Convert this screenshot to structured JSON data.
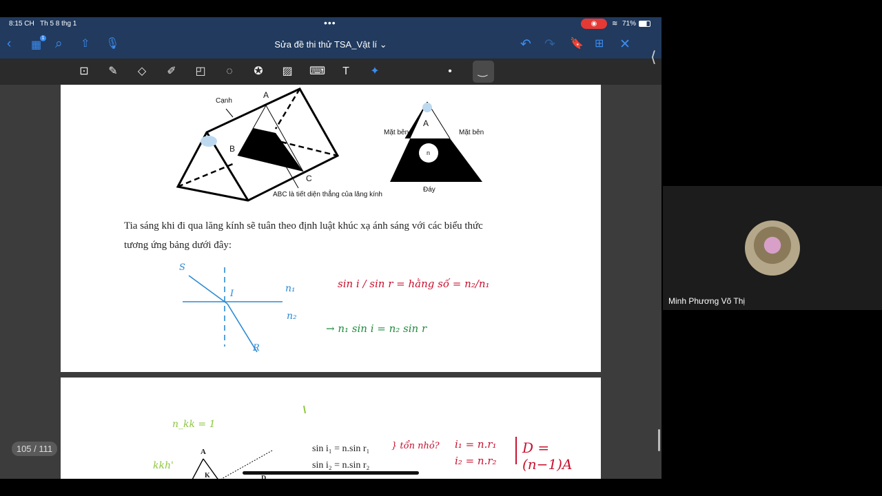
{
  "status": {
    "time": "8:15 CH",
    "date": "Th 5 8 thg 1",
    "battery": "71%"
  },
  "nav": {
    "title": "Sửa đề thi thử TSA_Vật lí",
    "badge": "1"
  },
  "toolbar": {
    "tools": [
      "lasso-zoom",
      "pen",
      "eraser",
      "highlighter",
      "shapes",
      "lasso",
      "sticker",
      "image",
      "keyboard",
      "text",
      "laser-pointer"
    ]
  },
  "page1": {
    "labels": {
      "canh": "Cạnh",
      "a": "A",
      "b": "B",
      "c": "C",
      "caption": "ABC là tiết diện thẳng của lăng kính",
      "a2": "A",
      "mat_ben_left": "Mặt bên",
      "mat_ben_right": "Mặt bên",
      "n": "n",
      "day": "Đáy"
    },
    "paragraph_line1": "Tia sáng khi đi qua lăng kính sẽ tuân theo định luật khúc xạ ánh sáng với các biểu thức",
    "paragraph_line2": "tương ứng bảng dưới đây:",
    "hand": {
      "s": "S",
      "i": "I",
      "r": "R",
      "n1": "n₁",
      "n2": "n₂",
      "formula1": "sin i / sin r = hằng số = n₂/n₁",
      "formula2": "→ n₁ sin i = n₂ sin r"
    }
  },
  "page2": {
    "hand": {
      "nkk": "n_kk = 1",
      "kkh": "kkh'",
      "note": "} tổn nhỏ?",
      "eq1": "i₁ = n.r₁",
      "eq2": "i₂ = n.r₂",
      "eq3": "D = (n−1)A"
    },
    "labels": {
      "a": "A",
      "k": "K",
      "d": "D"
    },
    "formula1": "sin i₁ = n.sin r₁",
    "formula2": "sin i₂ = n.sin r₂"
  },
  "page_indicator": "105 / 111",
  "participant": {
    "name": "Minh Phương Võ Thị"
  },
  "colors": {
    "nav_bg": "#213a5e",
    "accent": "#3d8cf0",
    "ink_blue": "#2a8ad4",
    "ink_red": "#c8102e",
    "ink_green": "#1f8a3c",
    "ink_lime": "#8dc63f"
  }
}
